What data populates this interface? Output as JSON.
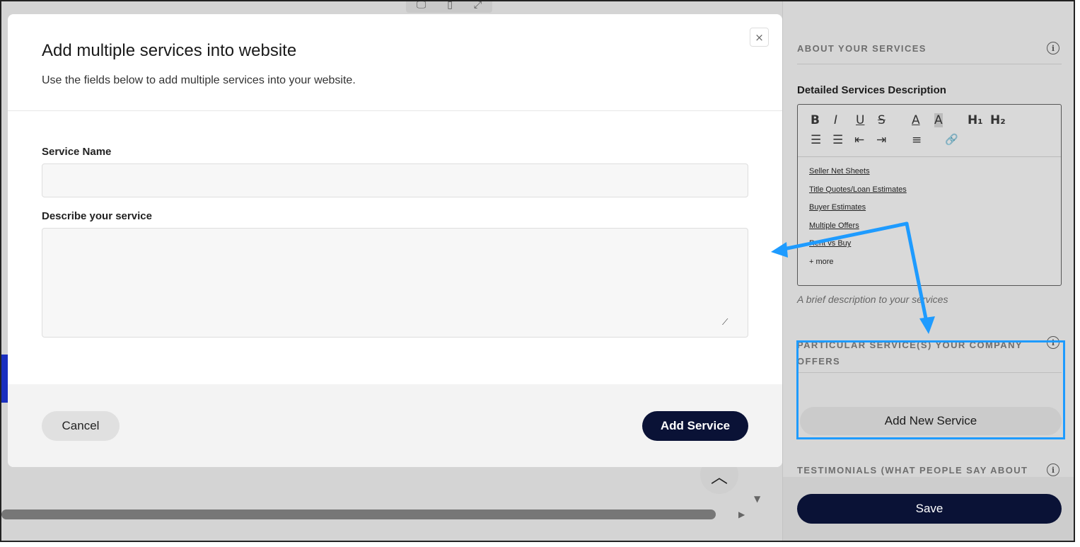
{
  "modal": {
    "title": "Add multiple services into website",
    "subtitle": "Use the fields below to add multiple services into your website.",
    "close_glyph": "×",
    "service_name_label": "Service Name",
    "service_name_value": "",
    "description_label": "Describe your service",
    "description_value": "",
    "cancel_label": "Cancel",
    "add_service_label": "Add Service"
  },
  "panel": {
    "about_title": "ABOUT YOUR SERVICES",
    "detailed_label": "Detailed Services Description",
    "toolbar": {
      "bold": "B",
      "italic": "I",
      "underline": "U",
      "strike": "S",
      "font_color": "A",
      "bg_color": "A",
      "h1": "H₁",
      "h2": "H₂",
      "ordered_list": "☰",
      "bullet_list": "☰",
      "outdent": "⇤",
      "indent": "⇥",
      "align": "≡",
      "link": "🔗"
    },
    "editor_items": [
      "Seller Net Sheets",
      "Title Quotes/Loan Estimates",
      "Buyer Estimates",
      "Multiple Offers",
      "Rent vs Buy"
    ],
    "editor_more": "+ more",
    "hint": "A brief description to your services",
    "particular_title": "PARTICULAR SERVICE(S) YOUR COMPANY OFFERS",
    "add_new_label": "Add New Service",
    "testimonials_title": "TESTIMONIALS (WHAT PEOPLE SAY ABOUT",
    "save_label": "Save",
    "info_glyph": "i"
  },
  "background": {
    "chevron_up": "︿",
    "scroll_right": "▶",
    "scroll_down": "▼"
  },
  "annotation": {
    "arrow_color": "#1e9bff"
  },
  "colors": {
    "primary_navy": "#0a1236",
    "highlight_blue": "#1e9bff"
  }
}
